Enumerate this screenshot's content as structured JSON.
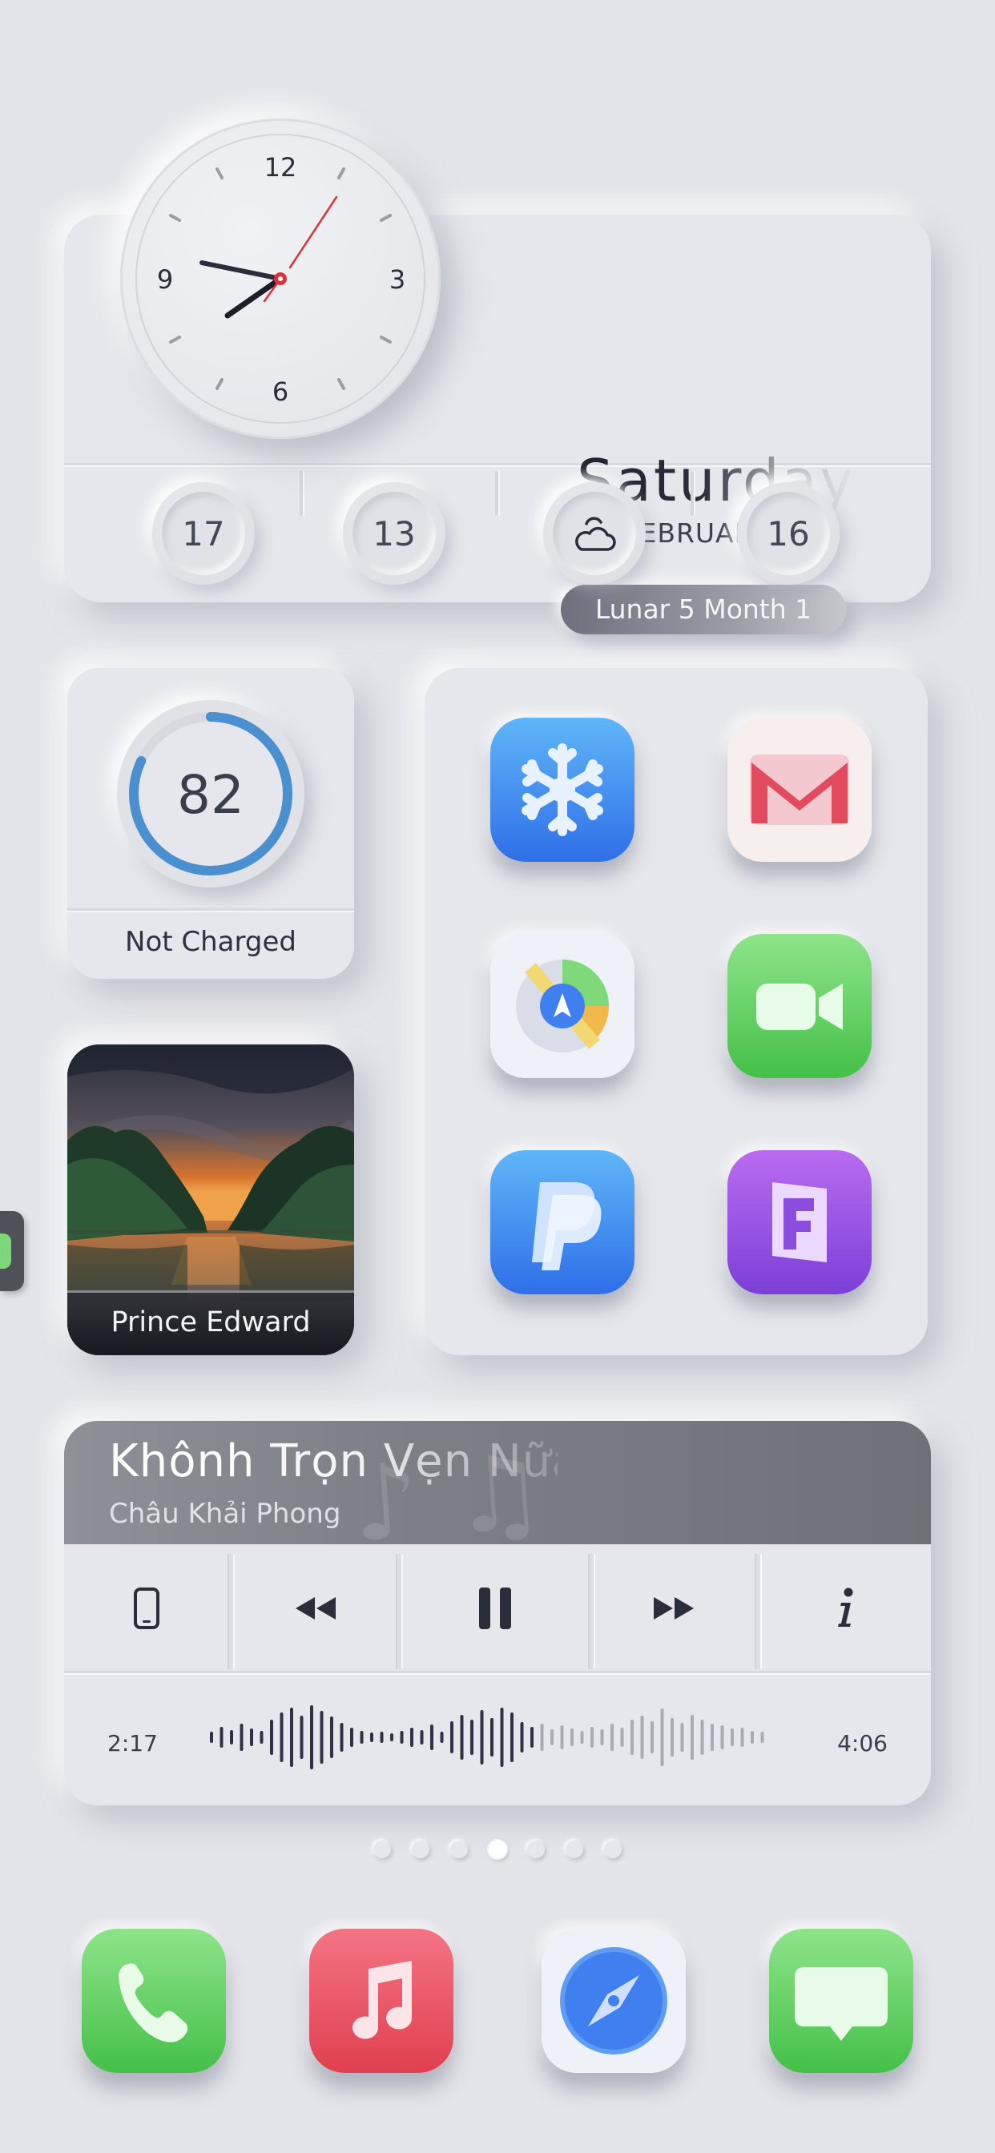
{
  "clock_widget": {
    "numerals": [
      "12",
      "3",
      "6",
      "9"
    ],
    "day_name": "Saturday",
    "date": "05 FEBRUARY",
    "lunar": "Lunar 5 Month 1",
    "info": [
      "17",
      "13",
      "16"
    ],
    "weather_icon": "partly-cloudy-icon"
  },
  "battery_widget": {
    "value": "82",
    "level_percent": 82,
    "status": "Not Charged",
    "ring_color": "#4a8fd0"
  },
  "photo_widget": {
    "caption": "Prince Edward"
  },
  "app_grid": {
    "apps": [
      {
        "icon": "snowflake-app-icon",
        "color": "#3f8af0"
      },
      {
        "icon": "gmail-app-icon",
        "color": "#e24b5e"
      },
      {
        "icon": "maps-app-icon",
        "color": "#4a7bd8"
      },
      {
        "icon": "facetime-app-icon",
        "color": "#5fd25f"
      },
      {
        "icon": "paypal-app-icon",
        "color": "#3f7ff0"
      },
      {
        "icon": "fantastical-app-icon",
        "color": "#9a4fe0"
      }
    ]
  },
  "music_widget": {
    "title": "Khônh Trọn Vẹn Nữa",
    "artist": "Châu Khải Phong",
    "elapsed": "2:17",
    "total": "4:06",
    "controls": [
      "device-icon",
      "rewind-icon",
      "pause-icon",
      "fast-forward-icon",
      "info-icon"
    ]
  },
  "page_indicator": {
    "count": 7,
    "active": 3
  },
  "dock": {
    "apps": [
      {
        "icon": "phone-icon",
        "color": "#5ed163"
      },
      {
        "icon": "music-icon",
        "color": "#ea4f61"
      },
      {
        "icon": "safari-icon",
        "color": "#3f7ff0"
      },
      {
        "icon": "messages-icon",
        "color": "#5ed163"
      }
    ]
  }
}
